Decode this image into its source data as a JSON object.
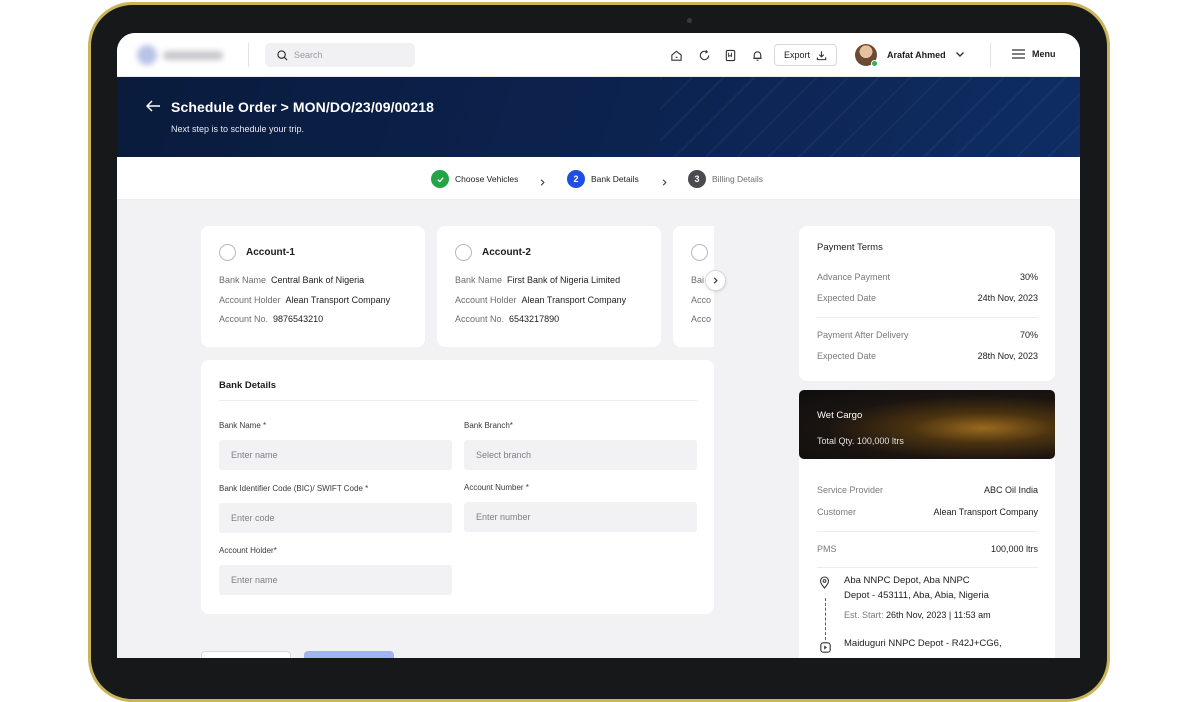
{
  "topbar": {
    "search_placeholder": "Search",
    "export_label": "Export",
    "user_name": "Arafat Ahmed",
    "menu_label": "Menu"
  },
  "hero": {
    "title": "Schedule Order > MON/DO/23/09/00218",
    "subtitle": "Next step is to schedule your trip."
  },
  "stepper": {
    "steps": [
      {
        "label": "Choose Vehicles",
        "state": "done"
      },
      {
        "label": "Bank Details",
        "number": "2",
        "state": "active"
      },
      {
        "label": "Billing Details",
        "number": "3",
        "state": "upcoming"
      }
    ]
  },
  "accounts": [
    {
      "title": "Account-1",
      "bank_name_label": "Bank Name",
      "bank_name": "Central Bank of Nigeria",
      "holder_label": "Account Holder",
      "holder": "Alean Transport Company",
      "number_label": "Account No.",
      "number": "9876543210"
    },
    {
      "title": "Account-2",
      "bank_name_label": "Bank Name",
      "bank_name": "First Bank of Nigeria Limited",
      "holder_label": "Account Holder",
      "holder": "Alean Transport Company",
      "number_label": "Account No.",
      "number": "6543217890"
    },
    {
      "bank_name_label": "Bai",
      "holder_label": "Acco",
      "number_label": "Acco"
    }
  ],
  "bank_form": {
    "title": "Bank Details",
    "bank_name_label": "Bank Name *",
    "bank_name_placeholder": "Enter name",
    "branch_label": "Bank Branch*",
    "branch_placeholder": "Select branch",
    "swift_label": "Bank Identifier Code (BIC)/ SWIFT Code *",
    "swift_placeholder": "Enter code",
    "acc_number_label": "Account Number *",
    "acc_number_placeholder": "Enter number",
    "holder_label": "Account Holder*",
    "holder_placeholder": "Enter name"
  },
  "payment_terms": {
    "title": "Payment Terms",
    "advance_label": "Advance Payment",
    "advance_value": "30%",
    "advance_date_label": "Expected Date",
    "advance_date": "24th Nov, 2023",
    "after_label": "Payment After Delivery",
    "after_value": "70%",
    "after_date_label": "Expected Date",
    "after_date": "28th Nov, 2023"
  },
  "cargo": {
    "title": "Wet Cargo",
    "quantity": "Total Qty. 100,000 ltrs"
  },
  "order": {
    "provider_label": "Service Provider",
    "provider": "ABC Oil India",
    "customer_label": "Customer",
    "customer": "Alean Transport Company",
    "product_label": "PMS",
    "product_qty": "100,000 ltrs",
    "origin_line1": "Aba NNPC Depot, Aba NNPC",
    "origin_line2": "Depot - 453111, Aba, Abia, Nigeria",
    "start_label": "Est. Start:",
    "start_value": "26th Nov, 2023 | 11:53 am",
    "destination": "Maiduguri NNPC Depot - R42J+CG6,"
  },
  "colors": {
    "brand_navy": "#0c2350",
    "step_done": "#22a447",
    "step_active": "#1f4fe0",
    "step_upcoming": "#4a4a4f"
  }
}
